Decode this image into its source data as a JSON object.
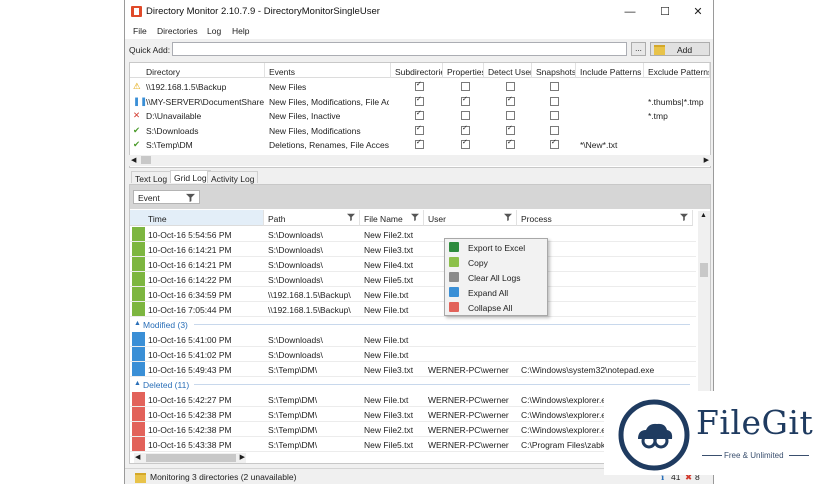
{
  "window": {
    "title": "Directory Monitor 2.10.7.9 - DirectoryMonitorSingleUser",
    "minimize": "—",
    "maximize": "☐",
    "close": "✕"
  },
  "menu": [
    "File",
    "Directories",
    "Log",
    "Help"
  ],
  "quick_add": {
    "label": "Quick Add:",
    "value": "",
    "browse": "...",
    "add_button": "Add"
  },
  "directories": {
    "columns": [
      "Directory",
      "Events",
      "Subdirectories",
      "Properties",
      "Detect Users",
      "Snapshots",
      "Include Patterns",
      "Exclude Patterns"
    ],
    "rows": [
      {
        "status": "warning",
        "status_glyph": "⚠",
        "dir": "\\\\192.168.1.5\\Backup",
        "events": "New Files",
        "sub": true,
        "prop": false,
        "users": false,
        "snap": false,
        "include": "",
        "exclude": ""
      },
      {
        "status": "paused",
        "status_glyph": "❚❚",
        "dir": "\\\\MY-SERVER\\DocumentShare",
        "events": "New Files, Modifications, File Access",
        "sub": true,
        "prop": true,
        "users": true,
        "snap": false,
        "include": "",
        "exclude": "*.thumbs|*.tmp"
      },
      {
        "status": "unavailable",
        "status_glyph": "✕",
        "dir": "D:\\Unavailable",
        "events": "New Files, Inactive",
        "sub": true,
        "prop": false,
        "users": false,
        "snap": false,
        "include": "",
        "exclude": "*.tmp"
      },
      {
        "status": "ok",
        "status_glyph": "✔",
        "dir": "S:\\Downloads",
        "events": "New Files, Modifications",
        "sub": true,
        "prop": true,
        "users": true,
        "snap": false,
        "include": "",
        "exclude": ""
      },
      {
        "status": "ok",
        "status_glyph": "✔",
        "dir": "S:\\Temp\\DM",
        "events": "Deletions, Renames, File Access, In...",
        "sub": true,
        "prop": true,
        "users": true,
        "snap": true,
        "include": "*\\New*.txt",
        "exclude": ""
      }
    ]
  },
  "tabs": [
    "Text Log",
    "Grid Log",
    "Activity Log"
  ],
  "active_tab": "Grid Log",
  "grid": {
    "group_chip": "Event",
    "columns": [
      "Time",
      "Path",
      "File Name",
      "User",
      "Process"
    ],
    "rows": [
      {
        "kind": "row",
        "color": "#7db640",
        "time": "10-Oct-16 5:54:56 PM",
        "path": "S:\\Downloads\\",
        "file": "New File2.txt",
        "user": "",
        "process": ""
      },
      {
        "kind": "row",
        "color": "#7db640",
        "time": "10-Oct-16 6:14:21 PM",
        "path": "S:\\Downloads\\",
        "file": "New File3.txt",
        "user": "",
        "process": ""
      },
      {
        "kind": "row",
        "color": "#7db640",
        "time": "10-Oct-16 6:14:21 PM",
        "path": "S:\\Downloads\\",
        "file": "New File4.txt",
        "user": "",
        "process": ""
      },
      {
        "kind": "row",
        "color": "#7db640",
        "time": "10-Oct-16 6:14:22 PM",
        "path": "S:\\Downloads\\",
        "file": "New File5.txt",
        "user": "",
        "process": ""
      },
      {
        "kind": "row",
        "color": "#7db640",
        "time": "10-Oct-16 6:34:59 PM",
        "path": "\\\\192.168.1.5\\Backup\\",
        "file": "New File.txt",
        "user": "",
        "process": ""
      },
      {
        "kind": "row",
        "color": "#7db640",
        "time": "10-Oct-16 7:05:44 PM",
        "path": "\\\\192.168.1.5\\Backup\\",
        "file": "New File.txt",
        "user": "",
        "process": ""
      },
      {
        "kind": "group",
        "label": "Modified (3)"
      },
      {
        "kind": "row",
        "color": "#3a8fd6",
        "time": "10-Oct-16 5:41:00 PM",
        "path": "S:\\Downloads\\",
        "file": "New File.txt",
        "user": "",
        "process": ""
      },
      {
        "kind": "row",
        "color": "#3a8fd6",
        "time": "10-Oct-16 5:41:02 PM",
        "path": "S:\\Downloads\\",
        "file": "New File.txt",
        "user": "",
        "process": ""
      },
      {
        "kind": "row",
        "color": "#3a8fd6",
        "time": "10-Oct-16 5:49:43 PM",
        "path": "S:\\Temp\\DM\\",
        "file": "New File3.txt",
        "user": "WERNER-PC\\werner",
        "process": "C:\\Windows\\system32\\notepad.exe"
      },
      {
        "kind": "group",
        "label": "Deleted (11)"
      },
      {
        "kind": "row",
        "color": "#e2625a",
        "time": "10-Oct-16 5:42:27 PM",
        "path": "S:\\Temp\\DM\\",
        "file": "New File.txt",
        "user": "WERNER-PC\\werner",
        "process": "C:\\Windows\\explorer.exe"
      },
      {
        "kind": "row",
        "color": "#e2625a",
        "time": "10-Oct-16 5:42:38 PM",
        "path": "S:\\Temp\\DM\\",
        "file": "New File3.txt",
        "user": "WERNER-PC\\werner",
        "process": "C:\\Windows\\explorer.exe"
      },
      {
        "kind": "row",
        "color": "#e2625a",
        "time": "10-Oct-16 5:42:38 PM",
        "path": "S:\\Temp\\DM\\",
        "file": "New File2.txt",
        "user": "WERNER-PC\\werner",
        "process": "C:\\Windows\\explorer.exe"
      },
      {
        "kind": "row",
        "color": "#e2625a",
        "time": "10-Oct-16 5:43:38 PM",
        "path": "S:\\Temp\\DM\\",
        "file": "New File5.txt",
        "user": "WERNER-PC\\werner",
        "process": "C:\\Program Files\\zabkat"
      }
    ]
  },
  "context_menu": [
    {
      "label": "Export to Excel",
      "icon": "excel-icon",
      "color": "#2e8b3e"
    },
    {
      "label": "Copy",
      "icon": "copy-icon",
      "color": "#8cc04a"
    },
    {
      "label": "Clear All Logs",
      "icon": "trash-icon",
      "color": "#8a8a8a"
    },
    {
      "label": "Expand All",
      "icon": "expand-icon",
      "color": "#3a8fd6"
    },
    {
      "label": "Collapse All",
      "icon": "collapse-icon",
      "color": "#e2625a"
    }
  ],
  "status": {
    "text": "Monitoring 3 directories (2 unavailable)",
    "count_info": "41",
    "count_errors": "8"
  },
  "watermark": {
    "brand": "FileGit",
    "tagline": "Free & Unlimited"
  }
}
